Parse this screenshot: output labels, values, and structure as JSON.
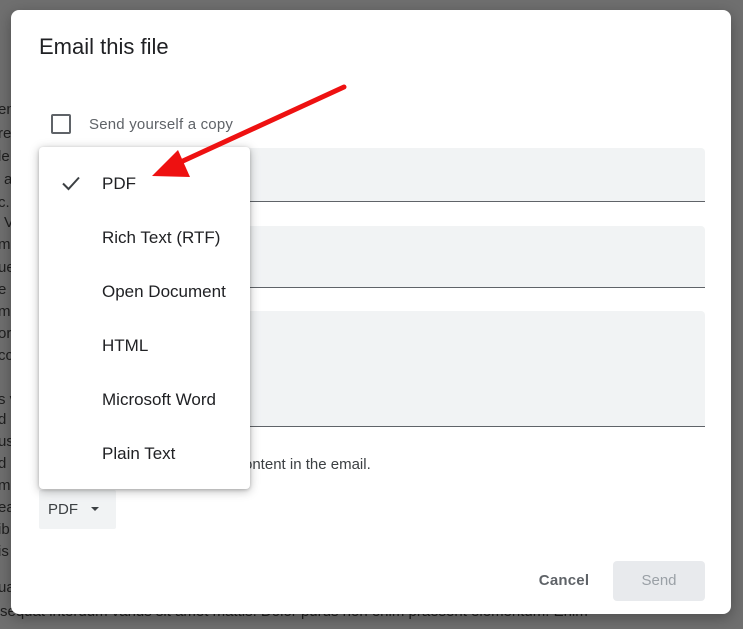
{
  "background_doc": {
    "fragments": [
      "em",
      "re",
      "le",
      "a",
      "c.",
      "V",
      "m",
      "ue",
      "e u",
      "m",
      "or",
      "cc",
      "s v",
      "d",
      "us",
      "d",
      "m",
      "ea",
      "ib",
      "is",
      "ua"
    ],
    "bottom_line": "sequat interdum varius sit amet mattis. Dolor purus non enim praesent elementum. Enim"
  },
  "dialog": {
    "title": "Email this file",
    "send_copy_label": "Send yourself a copy",
    "send_copy_checked": false,
    "note_text": "ontent in the email.",
    "format_button_label": "PDF",
    "cancel_label": "Cancel",
    "send_label": "Send"
  },
  "format_menu": {
    "selected": "PDF",
    "items": [
      {
        "label": "PDF",
        "checked": true
      },
      {
        "label": "Rich Text (RTF)",
        "checked": false
      },
      {
        "label": "Open Document",
        "checked": false
      },
      {
        "label": "HTML",
        "checked": false
      },
      {
        "label": "Microsoft Word",
        "checked": false
      },
      {
        "label": "Plain Text",
        "checked": false
      }
    ]
  },
  "colors": {
    "scrim": "#6f6f6f",
    "annotation_arrow": "#ee1111",
    "field_fill": "#f1f3f4"
  }
}
